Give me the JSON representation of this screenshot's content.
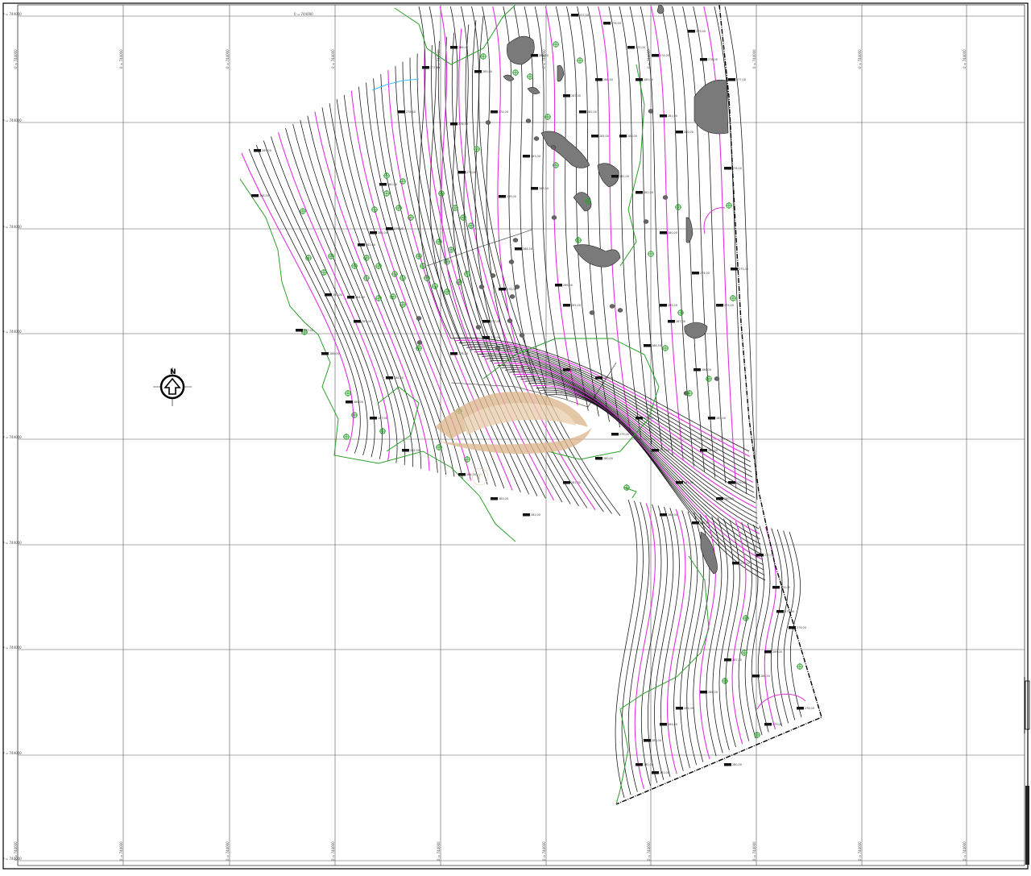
{
  "colors": {
    "contour": "#111111",
    "index_contour": "#e030e0",
    "vegetation": "#2aa02a",
    "rock": "#7a7a7a",
    "watercourse": "#3fc0ff",
    "watermark": "#dcb58a"
  },
  "grid": {
    "top_labels": [
      "0 = 744000",
      "0 = 744000",
      "0 = 744000",
      "0 = 744000",
      "0 = 744000",
      "0 = 744000",
      "0 = 744000",
      "0 = 744000",
      "0 = 744000",
      "0 = 744000"
    ],
    "left_labels": [
      "0 = 744000",
      "0 = 744000",
      "0 = 744000",
      "0 = 744000",
      "0 = 744000",
      "0 = 744000",
      "0 = 744000",
      "0 = 744000",
      "0 = 744000"
    ]
  },
  "north_arrow": {
    "letter": "N",
    "icon": "north-arrow-icon"
  },
  "watermark": {
    "icon": "company-logo-watermark"
  },
  "spot_heights": [
    "289,00",
    "288,50",
    "287,00",
    "286,00",
    "285,00",
    "284,00",
    "283,00",
    "282,00",
    "281,00",
    "280,00",
    "279,00",
    "278,00",
    "277,00",
    "276,00",
    "275,00",
    "274,00"
  ]
}
